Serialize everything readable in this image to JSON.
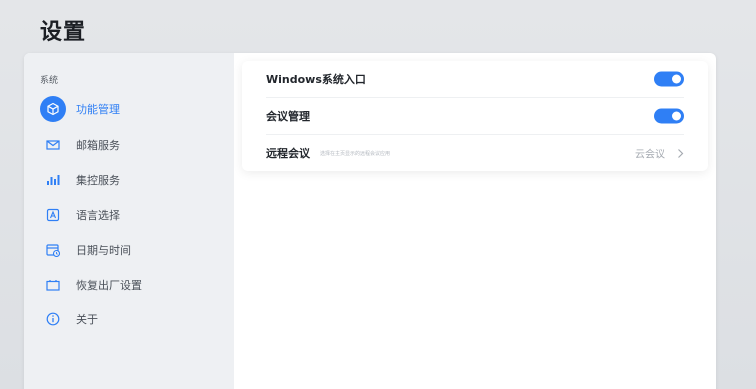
{
  "page": {
    "title": "设置"
  },
  "sidebar": {
    "section_label": "系统",
    "items": [
      {
        "label": "功能管理",
        "icon": "cube-icon",
        "active": true
      },
      {
        "label": "邮箱服务",
        "icon": "mail-icon",
        "active": false
      },
      {
        "label": "集控服务",
        "icon": "bar-chart-icon",
        "active": false
      },
      {
        "label": "语言选择",
        "icon": "language-icon",
        "active": false
      },
      {
        "label": "日期与时间",
        "icon": "calendar-clock-icon",
        "active": false
      },
      {
        "label": "恢复出厂设置",
        "icon": "reset-icon",
        "active": false
      },
      {
        "label": "关于",
        "icon": "info-icon",
        "active": false
      }
    ]
  },
  "settings": {
    "windows_entry": {
      "label": "Windows系统入口",
      "enabled": true
    },
    "meeting_management": {
      "label": "会议管理",
      "enabled": true
    },
    "remote_meeting": {
      "label": "远程会议",
      "description": "选择在主页显示的远程会议应用",
      "value": "云会议"
    }
  },
  "colors": {
    "accent": "#2f7ff5",
    "sidebar_bg": "#eef0f3",
    "page_bg": "#e0e3e6"
  }
}
